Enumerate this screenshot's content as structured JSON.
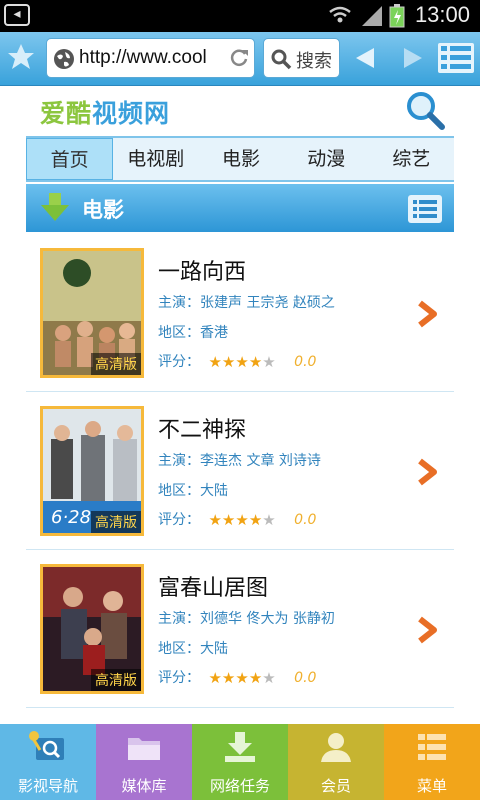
{
  "status_bar": {
    "time": "13:00"
  },
  "browser": {
    "url": "http://www.cool",
    "search_label": "搜索"
  },
  "site": {
    "logo_part1": "爱酷",
    "logo_part2": "视频网"
  },
  "tabs": [
    {
      "label": "首页",
      "active": true
    },
    {
      "label": "电视剧",
      "active": false
    },
    {
      "label": "电影",
      "active": false
    },
    {
      "label": "动漫",
      "active": false
    },
    {
      "label": "综艺",
      "active": false
    }
  ],
  "section": {
    "title": "电影"
  },
  "labels": {
    "cast": "主演：",
    "region": "地区：",
    "rating": "评分：",
    "hd_badge": "高清版"
  },
  "movies": [
    {
      "title": "一路向西",
      "cast": "张建声 王宗尧 赵硕之",
      "region": "香港",
      "score": "0.0",
      "stars": 4.5
    },
    {
      "title": "不二神探",
      "cast": "李连杰 文章 刘诗诗",
      "region": "大陆",
      "score": "0.0",
      "stars": 4.5
    },
    {
      "title": "富春山居图",
      "cast": "刘德华 佟大为 张静初",
      "region": "大陆",
      "score": "0.0",
      "stars": 4.5
    }
  ],
  "bottom_nav": [
    {
      "label": "影视导航",
      "color": "#5fb8e6",
      "icon": "film-search-icon"
    },
    {
      "label": "媒体库",
      "color": "#a874d0",
      "icon": "folder-icon"
    },
    {
      "label": "网络任务",
      "color": "#7cc03a",
      "icon": "download-icon"
    },
    {
      "label": "会员",
      "color": "#c6b431",
      "icon": "user-icon"
    },
    {
      "label": "菜单",
      "color": "#f2a51a",
      "icon": "menu-icon"
    }
  ]
}
